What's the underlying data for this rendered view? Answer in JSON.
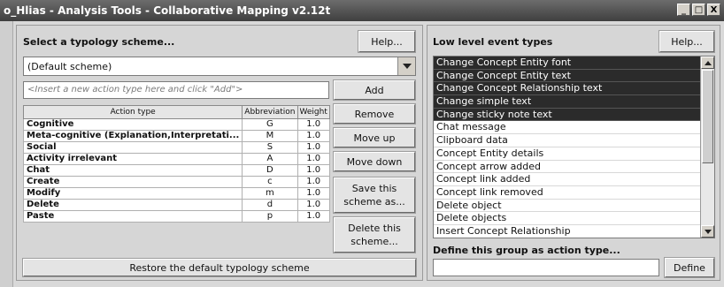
{
  "window": {
    "title": "o_Hlias - Analysis Tools - Collaborative Mapping v2.12t",
    "minimize": "_",
    "maximize": "□",
    "close": "X"
  },
  "left": {
    "heading": "Select a typology scheme...",
    "help_label": "Help...",
    "scheme_value": "(Default scheme)",
    "new_action_placeholder": "<Insert a new action type here and click \"Add\">",
    "add_label": "Add",
    "remove_label": "Remove",
    "move_up_label": "Move up",
    "move_down_label": "Move down",
    "save_label": "Save this scheme as...",
    "delete_label": "Delete this scheme...",
    "restore_label": "Restore the default typology scheme",
    "columns": [
      "Action type",
      "Abbreviation",
      "Weight"
    ],
    "rows": [
      {
        "name": "Cognitive",
        "abbr": "G",
        "weight": "1.0"
      },
      {
        "name": "Meta-cognitive (Explanation,Interpretati...",
        "abbr": "M",
        "weight": "1.0"
      },
      {
        "name": "Social",
        "abbr": "S",
        "weight": "1.0"
      },
      {
        "name": "Activity irrelevant",
        "abbr": "A",
        "weight": "1.0"
      },
      {
        "name": "Chat",
        "abbr": "D",
        "weight": "1.0"
      },
      {
        "name": "Create",
        "abbr": "c",
        "weight": "1.0"
      },
      {
        "name": "Modify",
        "abbr": "m",
        "weight": "1.0"
      },
      {
        "name": "Delete",
        "abbr": "d",
        "weight": "1.0"
      },
      {
        "name": "Paste",
        "abbr": "p",
        "weight": "1.0"
      }
    ]
  },
  "right": {
    "heading": "Low level event types",
    "help_label": "Help...",
    "events": [
      {
        "label": "Change Concept Entity font",
        "selected": true
      },
      {
        "label": "Change Concept Entity text",
        "selected": true
      },
      {
        "label": "Change Concept Relationship text",
        "selected": true
      },
      {
        "label": "Change simple text",
        "selected": true
      },
      {
        "label": "Change sticky note text",
        "selected": true
      },
      {
        "label": "Chat message",
        "selected": false
      },
      {
        "label": "Clipboard data",
        "selected": false
      },
      {
        "label": "Concept Entity details",
        "selected": false
      },
      {
        "label": "Concept arrow added",
        "selected": false
      },
      {
        "label": "Concept link added",
        "selected": false
      },
      {
        "label": "Concept link removed",
        "selected": false
      },
      {
        "label": "Delete object",
        "selected": false
      },
      {
        "label": "Delete objects",
        "selected": false
      },
      {
        "label": "Insert Concept Relationship",
        "selected": false
      }
    ],
    "define_heading": "Define this group as action type...",
    "define_value": "",
    "define_label": "Define"
  }
}
